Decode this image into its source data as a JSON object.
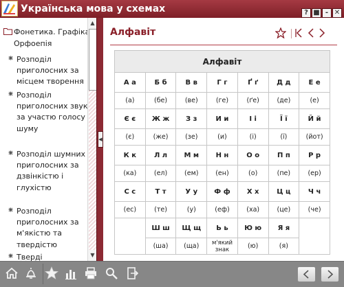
{
  "app": {
    "title": "Українська мова у схемах"
  },
  "window_buttons": [
    "?",
    "■",
    "-",
    "✕"
  ],
  "sidebar": {
    "root": "Фонетика. Графіка. Орфоепія",
    "items": [
      "Розподіл приголосних за місцем творення",
      "Розподіл приголосних звуків за участю голосу і шуму",
      "Розподіл шумних приголосних за дзвінкістю і глухістю",
      "Розподіл приголосних за м'якістю та твердістю",
      "Тверді"
    ]
  },
  "content": {
    "title": "Алфавіт",
    "table_title": "Алфавіт",
    "rows": [
      [
        "А а",
        "Б б",
        "В в",
        "Г г",
        "Ґ ґ",
        "Д д",
        "Е е"
      ],
      [
        "(а)",
        "(бе)",
        "(ве)",
        "(ге)",
        "(ґе)",
        "(де)",
        "(е)"
      ],
      [
        "Є є",
        "Ж ж",
        "З з",
        "И и",
        "І і",
        "Ї ї",
        "Й й"
      ],
      [
        "(є)",
        "(же)",
        "(зе)",
        "(и)",
        "(і)",
        "(ї)",
        "(йот)"
      ],
      [
        "К к",
        "Л л",
        "М м",
        "Н н",
        "О о",
        "П п",
        "Р р"
      ],
      [
        "(ка)",
        "(ел)",
        "(ем)",
        "(ен)",
        "(о)",
        "(пе)",
        "(ер)"
      ],
      [
        "С с",
        "Т т",
        "У у",
        "Ф ф",
        "Х х",
        "Ц ц",
        "Ч ч"
      ],
      [
        "(ес)",
        "(те)",
        "(у)",
        "(еф)",
        "(ха)",
        "(це)",
        "(че)"
      ],
      [
        "Ш ш",
        "Щ щ",
        "Ь ь",
        "Ю ю",
        "Я я"
      ],
      [
        "(ша)",
        "(ща)",
        "м'який знак",
        "(ю)",
        "(я)"
      ]
    ]
  },
  "colors": {
    "brand": "#8a1f28",
    "accent": "#b23a44",
    "bottombar": "#878787"
  },
  "icons": {
    "toolbar": [
      "home-icon",
      "bell-icon",
      "star-icon",
      "chart-icon",
      "printer-icon",
      "search-icon",
      "exit-icon"
    ],
    "nav": [
      "star-outline-icon",
      "first-page-icon",
      "prev-page-icon",
      "next-page-icon"
    ]
  }
}
